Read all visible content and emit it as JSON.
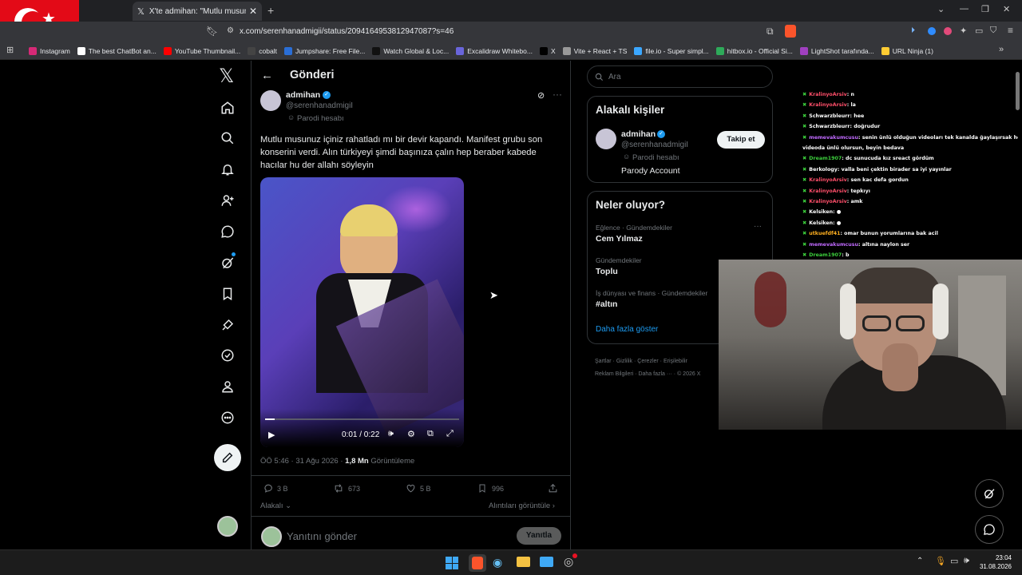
{
  "browser": {
    "tab_title": "X'te admihan: \"Mutlu musunuz i",
    "url": "x.com/serenhanadmigii/status/2094164953812947087?s=46",
    "bookmarks": [
      "Instagram",
      "The best ChatBot an...",
      "YouTube Thumbnail...",
      "cobalt",
      "Jumpshare: Free File...",
      "Watch Global & Loc...",
      "Excalidraw Whitebo...",
      "X",
      "Vite + React + TS",
      "file.io - Super simpl...",
      "hitbox.io - Official Si...",
      "LightShot tarafında...",
      "URL Ninja (1)"
    ],
    "bookmark_colors": [
      "#d62976",
      "#ffffff",
      "#ff0000",
      "#444444",
      "#2a6ed6",
      "#111111",
      "#6965db",
      "#000000",
      "#999999",
      "#3ba7ff",
      "#2eaa5a",
      "#a040c0",
      "#ffcc33"
    ]
  },
  "nav": {
    "items": [
      "home-icon",
      "explore-icon",
      "notifications-icon",
      "follow-icon",
      "messages-icon",
      "grok-icon",
      "bookmarks-icon",
      "premium-icon",
      "verified-icon",
      "profile-icon",
      "more-icon"
    ]
  },
  "main": {
    "header_title": "Gönderi",
    "author_name": "admihan",
    "author_handle": "@serenhanadmigiI",
    "author_label": "Parodi hesabı",
    "tweet_text_1": "Mutlu musunuz içiniz rahatladı mı bir devir kapandı. Manifest grubu son",
    "tweet_text_2": "konserini verdi. Alın türkiyeyi şimdi başınıza çalın hep beraber kabede",
    "tweet_text_3": "hacılar hu der allahı söyleyin",
    "video_time": "0:01 / 0:22",
    "video_progress": 0.05,
    "meta_time": "ÖÖ 5:46 · 31 Ağu 2026 · ",
    "views_value": "1,8 Mn",
    "views_label": " Görüntüleme",
    "replies": "3 B",
    "reposts": "673",
    "likes": "5 B",
    "bookmarks": "996",
    "relevant_label": "Alakalı",
    "quotes_label": "Alıntıları görüntüle",
    "reply_placeholder": "Yanıtını gönder",
    "reply_button": "Yanıtla"
  },
  "right": {
    "search_placeholder": "Ara",
    "related_title": "Alakalı kişiler",
    "related_name": "admihan",
    "related_handle": "@serenhanadmigiI",
    "related_label": "Parodi hesabı",
    "related_bio": "Parody Account",
    "follow_button": "Takip et",
    "trends_title": "Neler oluyor?",
    "trends": [
      {
        "context": "Eğlence · Gündemdekiler",
        "topic": "Cem Yılmaz"
      },
      {
        "context": "Gündemdekiler",
        "topic": "Toplu"
      },
      {
        "context": "İş dünyası ve finans · Gündemdekiler",
        "topic": "#altın"
      }
    ],
    "show_more": "Daha fazla göster",
    "footer_1": "Şartlar  ·  Gizlilik  ·  Çerezler  ·  Erişilebilir",
    "footer_2": "Reklam Bilgileri  ·  Daha fazla ···  ·  © 2026 X"
  },
  "chat": [
    {
      "user": "KralinyoArsiv",
      "msg": ": n",
      "color": "#ff4f6a"
    },
    {
      "user": "KralinyoArsiv",
      "msg": ": la",
      "color": "#ff4f6a"
    },
    {
      "user": "Schwarzbleurr",
      "msg": ": hee",
      "color": "#ffffff"
    },
    {
      "user": "Schwarzbleurr",
      "msg": ": doğrudur",
      "color": "#ffffff"
    },
    {
      "user": "memevakumcusu",
      "msg": ": senin ünlü olduğun videoları tek kanalda ğaylaşırsak her",
      "color": "#c06aff"
    },
    {
      "user": "",
      "msg": "videoda ünlü olursun, beyin bedava",
      "color": "#ffffff"
    },
    {
      "user": "Dream1907",
      "msg": ": dc sunucuda kız sreact gördüm",
      "color": "#3ccf3c"
    },
    {
      "user": "Berkology",
      "msg": ": valla beni çektin birader sa iyi yayınlar",
      "color": "#ffffff"
    },
    {
      "user": "KralinyoArsiv",
      "msg": ": sen kac defa gordun",
      "color": "#ff4f6a"
    },
    {
      "user": "KralinyoArsiv",
      "msg": ": tepkıyı",
      "color": "#ff4f6a"
    },
    {
      "user": "KralinyoArsiv",
      "msg": ": amk",
      "color": "#ff4f6a"
    },
    {
      "user": "Kelsiken",
      "msg": ": ●",
      "color": "#ffffff"
    },
    {
      "user": "Kelsiken",
      "msg": ": ●",
      "color": "#ffffff"
    },
    {
      "user": "utkuefdf41",
      "msg": ": omar bunun yorumlarına bak acil",
      "color": "#ffb020"
    },
    {
      "user": "memevakumcusu",
      "msg": ": altına naylon ser",
      "color": "#c06aff"
    },
    {
      "user": "Dream1907",
      "msg": ": b",
      "color": "#3ccf3c"
    }
  ],
  "taskbar": {
    "time": "23:04",
    "date": "31.08.2026"
  },
  "colors": {
    "verified": "#1d9bf0",
    "accent": "#1d9bf0",
    "muted": "#71767b"
  }
}
